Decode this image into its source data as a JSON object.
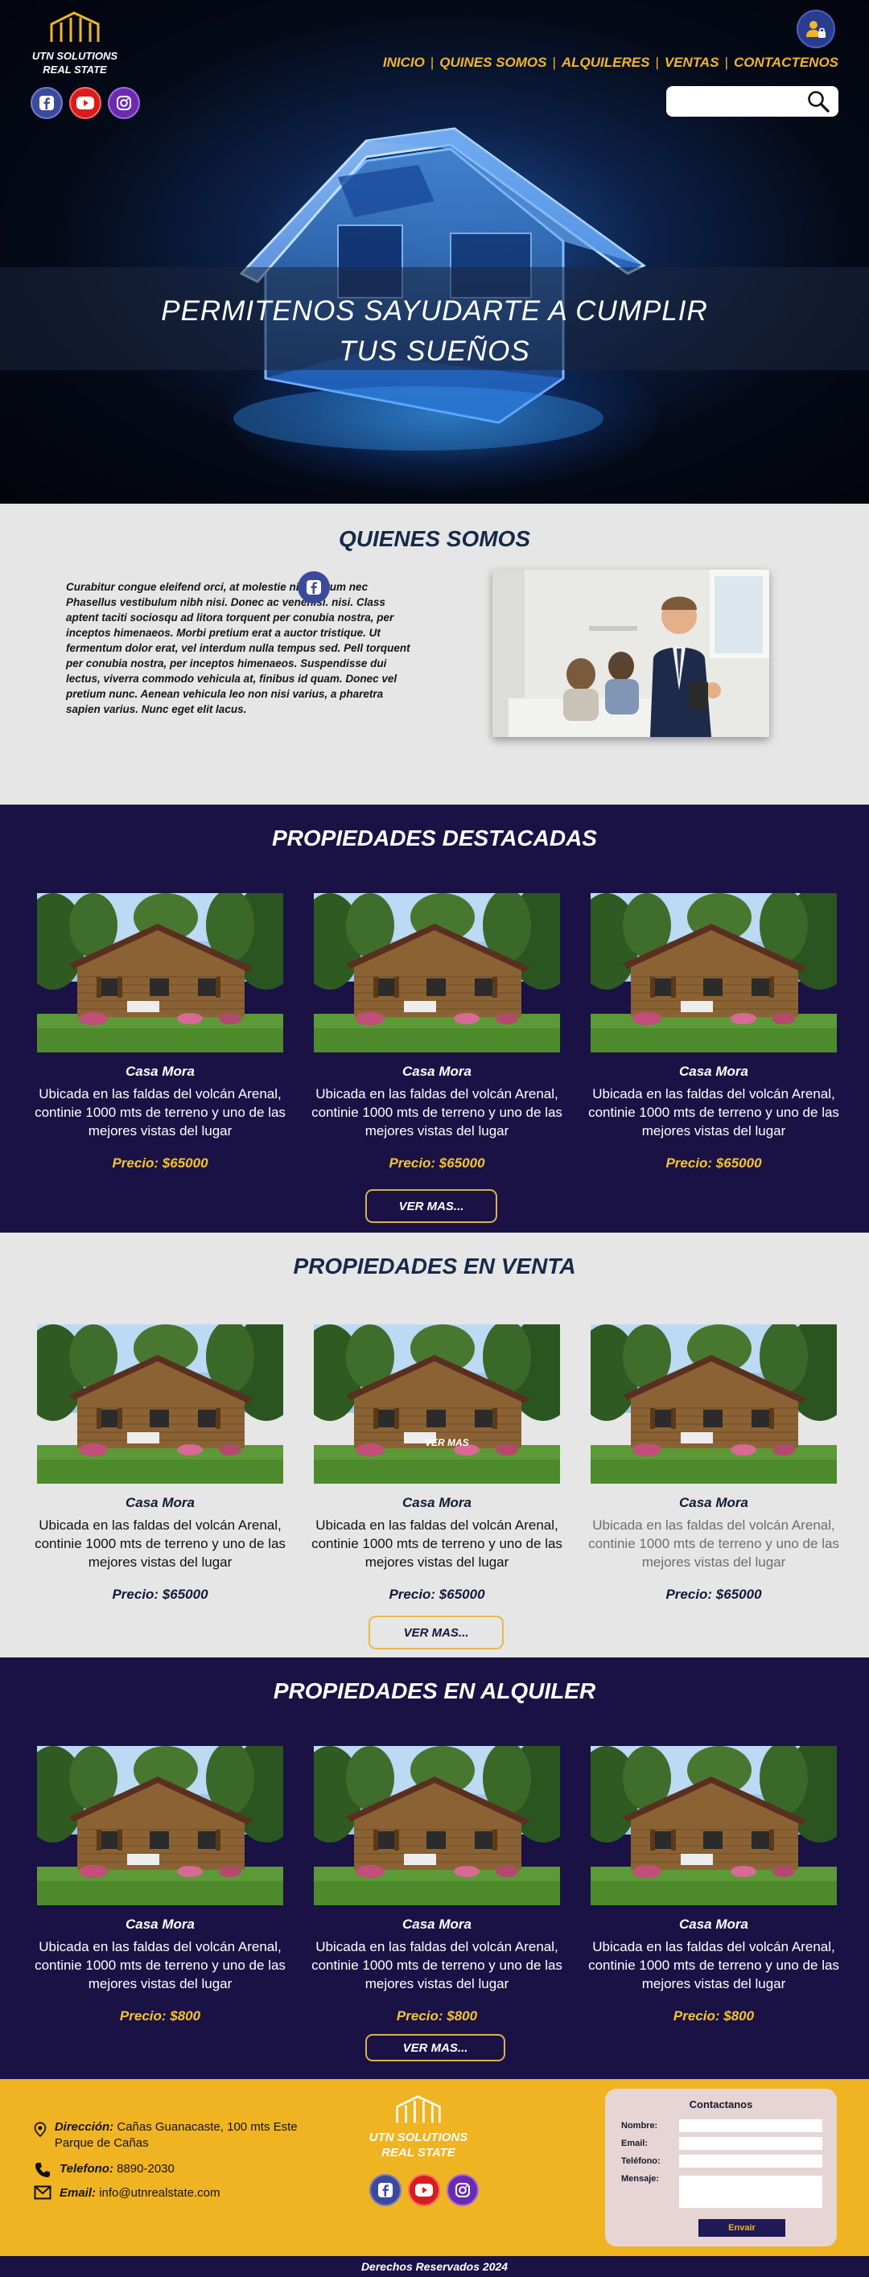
{
  "header": {
    "logo_line1": "UTN SOLUTIONS",
    "logo_line2": "REAL STATE",
    "nav": [
      "INICIO",
      "QUINES SOMOS",
      "ALQUILERES",
      "VENTAS",
      "CONTACTENOS"
    ],
    "search_placeholder": "",
    "hero_line1": "PERMITENOS SAYUDARTE A CUMPLIR",
    "hero_line2": "TUS SUEÑOS"
  },
  "about": {
    "title": "QUIENES SOMOS",
    "paragraph": "Curabitur congue eleifend orci, at molestie nisl rutrum nec Phasellus vestibulum nibh nisi. Donec ac venenisi. nisi. Class aptent taciti sociosqu ad litora torquent per conubia nostra, per inceptos himenaeos. Morbi pretium erat a auctor tristique. Ut fermentum dolor erat, vel interdum nulla tempus sed. Pell torquent per conubia nostra, per inceptos himenaeos. Suspendisse dui lectus, viverra commodo vehicula at, finibus id quam. Donec vel pretium nunc. Aenean vehicula leo non nisi varius, a pharetra sapien varius. Nunc eget elit lacus."
  },
  "featured": {
    "title": "PROPIEDADES DESTACADAS",
    "cards": [
      {
        "name": "Casa Mora",
        "desc": "Ubicada en las faldas del volcán Arenal, continie 1000 mts de terreno y uno de las mejores vistas del lugar",
        "price": "Precio: $65000"
      },
      {
        "name": "Casa Mora",
        "desc": "Ubicada en las faldas del volcán Arenal, continie 1000 mts de terreno y uno de las mejores vistas del lugar",
        "price": "Precio: $65000"
      },
      {
        "name": "Casa Mora",
        "desc": "Ubicada en las faldas del volcán Arenal, continie 1000 mts de terreno y uno de las mejores vistas del lugar",
        "price": "Precio: $65000"
      }
    ],
    "button": "VER MAS..."
  },
  "sale": {
    "title": "PROPIEDADES EN VENTA",
    "cards": [
      {
        "name": "Casa Mora",
        "desc": "Ubicada en las faldas del volcán Arenal, continie 1000 mts de terreno y uno de las mejores vistas del lugar",
        "price": "Precio: $65000"
      },
      {
        "name": "Casa Mora",
        "desc": "Ubicada en las faldas del volcán Arenal, continie 1000 mts de terreno y uno de las mejores vistas del lugar",
        "price": "Precio: $65000"
      },
      {
        "name": "Casa Mora",
        "desc": "Ubicada en las faldas del volcán Arenal, continie 1000 mts de terreno y uno de las mejores vistas del lugar",
        "price": "Precio: $65000"
      }
    ],
    "overlay": "VER MAS",
    "button": "VER MAS..."
  },
  "rent": {
    "title": "PROPIEDADES EN ALQUILER",
    "cards": [
      {
        "name": "Casa Mora",
        "desc": "Ubicada en las faldas del volcán Arenal, continie 1000 mts de terreno y uno de las mejores vistas del lugar",
        "price": "Precio: $800"
      },
      {
        "name": "Casa Mora",
        "desc": "Ubicada en las faldas del volcán Arenal, continie 1000 mts de terreno y uno de las mejores vistas del lugar",
        "price": "Precio: $800"
      },
      {
        "name": "Casa Mora",
        "desc": "Ubicada en las faldas del volcán Arenal, continie 1000 mts de terreno y uno de las mejores vistas del lugar",
        "price": "Precio: $800"
      }
    ],
    "button": "VER MAS..."
  },
  "footer": {
    "address_label": "Dirección:",
    "address": "Cañas Guanacaste, 100 mts Este Parque de Cañas",
    "phone_label": "Telefono:",
    "phone": "8890-2030",
    "email_label": "Email:",
    "email": "info@utnrealstate.com",
    "logo_line1": "UTN SOLUTIONS",
    "logo_line2": "REAL STATE",
    "form_title": "Contactanos",
    "form_name": "Nombre:",
    "form_email": "Email:",
    "form_phone": "Teléfono:",
    "form_message": "Mensaje:",
    "form_submit": "Envair",
    "copyright": "Derechos Reservados 2024"
  },
  "colors": {
    "navy": "#1a1245",
    "gold": "#f0b321",
    "light_gray": "#e6e6e6",
    "title_blue": "#162a4a"
  }
}
